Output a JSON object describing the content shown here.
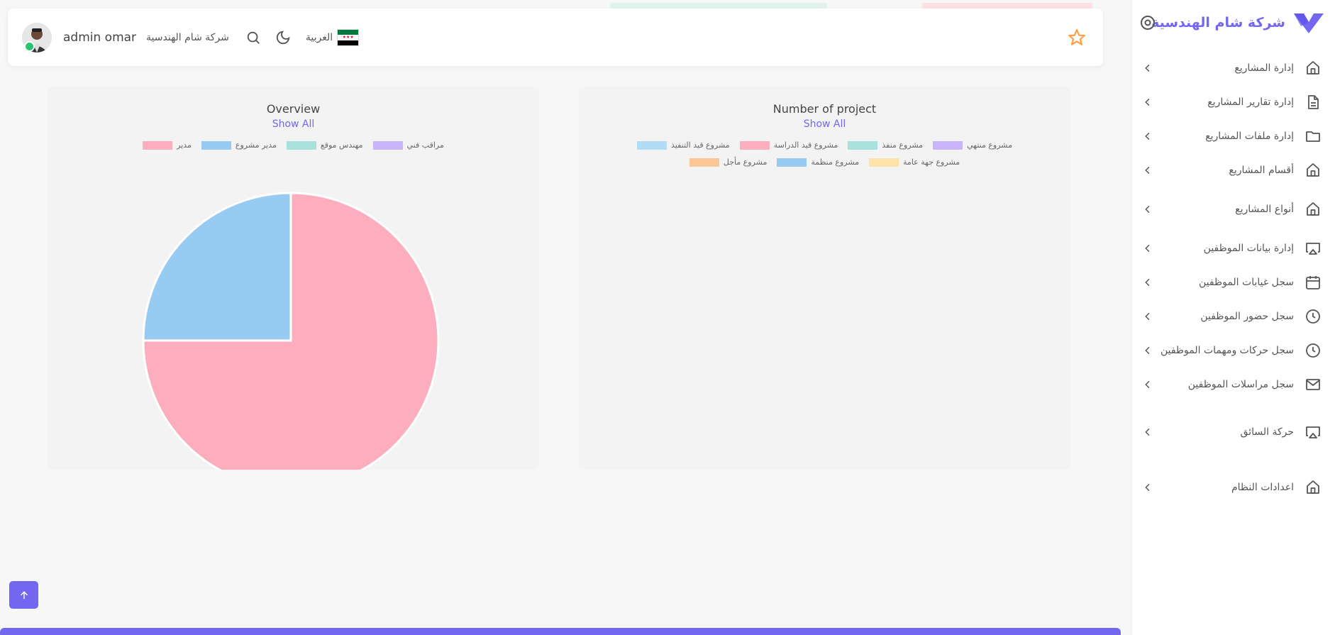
{
  "header": {
    "user_name": "admin omar",
    "company": "شركة شام الهندسية",
    "language": "العربية",
    "flag_colors": [
      "#007a3d",
      "#ffffff",
      "#000000"
    ]
  },
  "overview_card": {
    "title": "Overview",
    "show_all": "Show All",
    "legend": [
      {
        "label": "مراقب فني",
        "color": "#c9b3fb"
      },
      {
        "label": "مهندس موقع",
        "color": "#a8e0dc"
      },
      {
        "label": "مدير مشروع",
        "color": "#98cbf1"
      },
      {
        "label": "مدير",
        "color": "#fcadbe"
      }
    ],
    "chart_data": {
      "type": "pie",
      "labels": [
        "مدير",
        "مدير مشروع",
        "مهندس موقع",
        "مراقب فني"
      ],
      "values": [
        75,
        25,
        0,
        0
      ],
      "colors": [
        "#fcadbe",
        "#98cbf1",
        "#a8e0dc",
        "#c9b3fb"
      ]
    }
  },
  "projects_card": {
    "title": "Number of project",
    "show_all": "Show All",
    "legend_row1": [
      {
        "label": "مشروع منتهي",
        "color": "#c9b3fb"
      },
      {
        "label": "مشروع منفذ",
        "color": "#a8e0dc"
      },
      {
        "label": "مشروع قيد الدراسة",
        "color": "#fcadbe"
      },
      {
        "label": "مشروع قيد التنفيذ",
        "color": "#b2dcf5"
      }
    ],
    "legend_row2": [
      {
        "label": "مشروع جهة عامة",
        "color": "#fde3a7"
      },
      {
        "label": "مشروع منظمة",
        "color": "#98cbf1"
      },
      {
        "label": "مشروع مأجل",
        "color": "#fbc795"
      }
    ]
  },
  "sidebar": {
    "brand": "شركة شام الهندسية",
    "brand_color": "#7367f0",
    "items": [
      {
        "label": "إدارة المشاريع",
        "icon": "home-icon"
      },
      {
        "label": "إدارة تقارير المشاريع",
        "icon": "document-icon"
      },
      {
        "label": "إدارة ملفات المشاريع",
        "icon": "folder-icon"
      },
      {
        "label": "أقسام المشاريع",
        "icon": "home-icon"
      },
      {
        "label": "أنواع المشاريع",
        "icon": "home-icon"
      },
      {
        "label": "إدارة بيانات الموظفين",
        "icon": "airplay-icon"
      },
      {
        "label": "سجل غيابات الموظفين",
        "icon": "calendar-icon"
      },
      {
        "label": "سجل حضور الموظفين",
        "icon": "clock-icon"
      },
      {
        "label": "سجل حركات ومهمات الموظفين",
        "icon": "clock-icon"
      },
      {
        "label": "سجل مراسلات الموظفين",
        "icon": "mail-icon"
      },
      {
        "label": "حركة السائق",
        "icon": "airplay-icon"
      },
      {
        "label": "اعدادات النظام",
        "icon": "home-icon"
      }
    ]
  }
}
